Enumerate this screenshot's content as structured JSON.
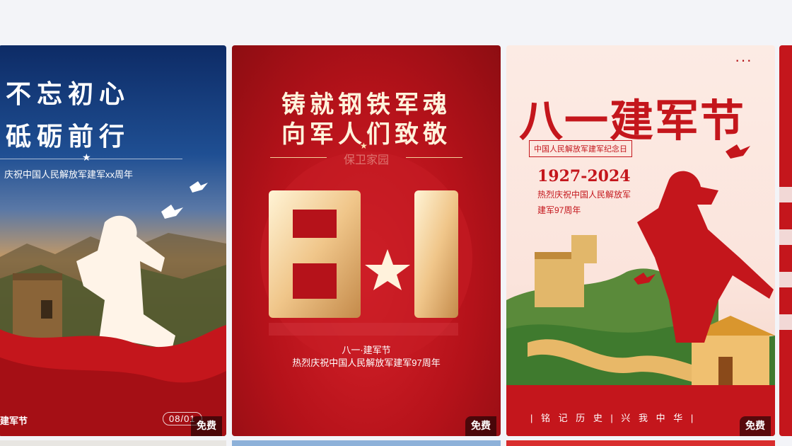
{
  "cards": [
    {
      "title_line1": "不忘初心",
      "title_line2": "砥砺前行",
      "subtitle": "庆祝中国人民解放军建军xx周年",
      "footer": "建军节",
      "date": "08/01",
      "badge": "免费",
      "colors": {
        "sky": "#1f4f93",
        "flag": "#c4161c"
      }
    },
    {
      "title_line1": "铸就钢铁军魂",
      "title_line2": "向军人们致敬",
      "subtitle": "保卫家园",
      "big_number": "8·1",
      "caption1": "八一·建军节",
      "caption2": "热烈庆祝中国人民解放军建军97周年",
      "badge": "免费",
      "colors": {
        "background": "#b5121a",
        "gold": "#f0c68a"
      }
    },
    {
      "more_icon": "···",
      "title": "八一建军节",
      "tag": "中国人民解放军建军纪念日",
      "years": "1927-2024",
      "subtitle_line1": "热烈庆祝中国人民解放军",
      "subtitle_line2": "建军97周年",
      "motto": "| 铭 记 历 史 | 兴 我 中 华 |",
      "badge": "免费",
      "colors": {
        "accent": "#c4161c",
        "paper": "#fbe4dc"
      }
    }
  ]
}
